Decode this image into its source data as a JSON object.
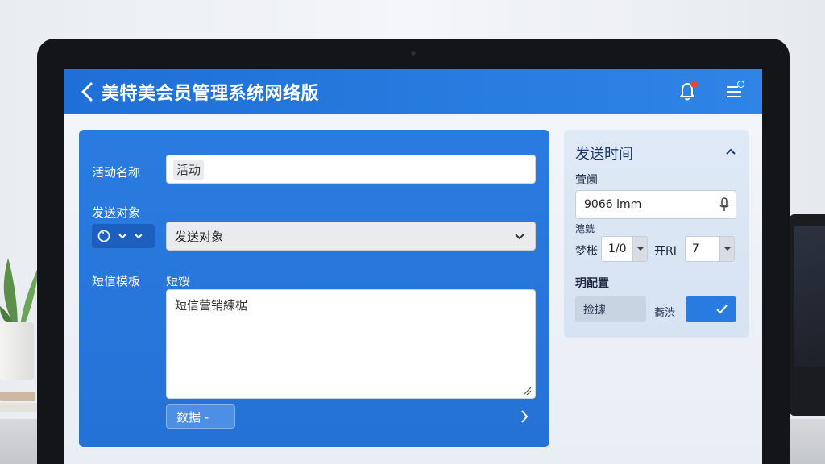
{
  "header": {
    "title": "美特美会员管理系统网络版"
  },
  "form": {
    "activity_name_label": "活动名称",
    "activity_name_value": "活动",
    "target_label": "发送对象",
    "target_select_value": "发送对象",
    "sms_template_label": "短信模板",
    "sms_sub_label": "短馁",
    "sms_text": "短信营销練椐",
    "data_button_label": "数据 -"
  },
  "side": {
    "title": "发送时间",
    "time_label": "萓阛",
    "time_value": "9066 lmm",
    "small_label": "滬皝",
    "spin1_label": "梦枨",
    "spin1_value": "1/0",
    "spin2_label": "开RI",
    "spin2_value": "7",
    "config_label": "玥配置",
    "check_label": "捡據",
    "confirm_prefix": "蕎渋"
  },
  "colors": {
    "topbar": "#2477e0",
    "card": "#2776dc",
    "panel": "#dbe6f4",
    "notification_dot": "#e8462e",
    "settings_dot": "#1e90ff"
  }
}
